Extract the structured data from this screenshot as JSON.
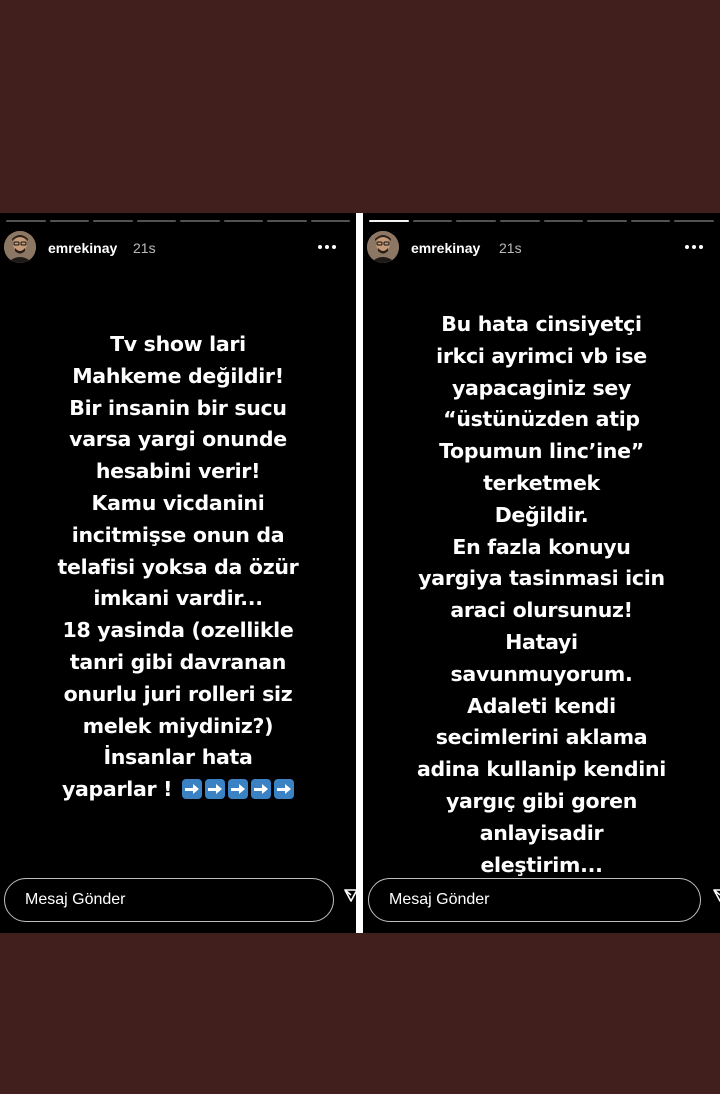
{
  "stories": [
    {
      "username": "emrekinay",
      "time": "21s",
      "progress_done": 0,
      "progress_segments": 8,
      "lines": [
        "Tv show lari",
        "Mahkeme değildir!",
        "Bir insanin bir sucu",
        "varsa yargi onunde",
        "hesabini verir!",
        "Kamu vicdanini",
        "incitmişse onun da",
        "telafisi yoksa da özür",
        "imkani vardir...",
        "18 yasinda (ozellikle",
        "tanri gibi davranan",
        "onurlu juri rolleri siz",
        "melek miydiniz?)",
        "İnsanlar hata",
        "yaparlar !"
      ],
      "trailing_icons": [
        "right-arrow-icon",
        "right-arrow-icon",
        "right-arrow-icon",
        "right-arrow-icon",
        "right-arrow-icon"
      ],
      "message_placeholder": "Mesaj Gönder"
    },
    {
      "username": "emrekinay",
      "time": "21s",
      "progress_done": 1,
      "progress_segments": 8,
      "lines": [
        "Bu hata cinsiyetçi",
        "irkci ayrimci vb ise",
        "yapacaginiz sey",
        "“üstünüzden atip",
        "Topumun linc’ine”",
        "terketmek",
        "Değildir.",
        "En fazla konuyu",
        "yargiya tasinmasi icin",
        "araci olursunuz!",
        "Hatayi",
        "savunmuyorum.",
        "Adaleti kendi",
        "secimlerini aklama",
        "adina kullanip kendini",
        "yargıç gibi goren",
        "anlayisadir",
        "eleştirim..."
      ],
      "message_placeholder": "Mesaj Gönder"
    }
  ],
  "colors": {
    "page_background": "#411f1c",
    "story_background": "#000000",
    "text": "#ffffff",
    "arrow_emoji": "#3b82c4"
  }
}
